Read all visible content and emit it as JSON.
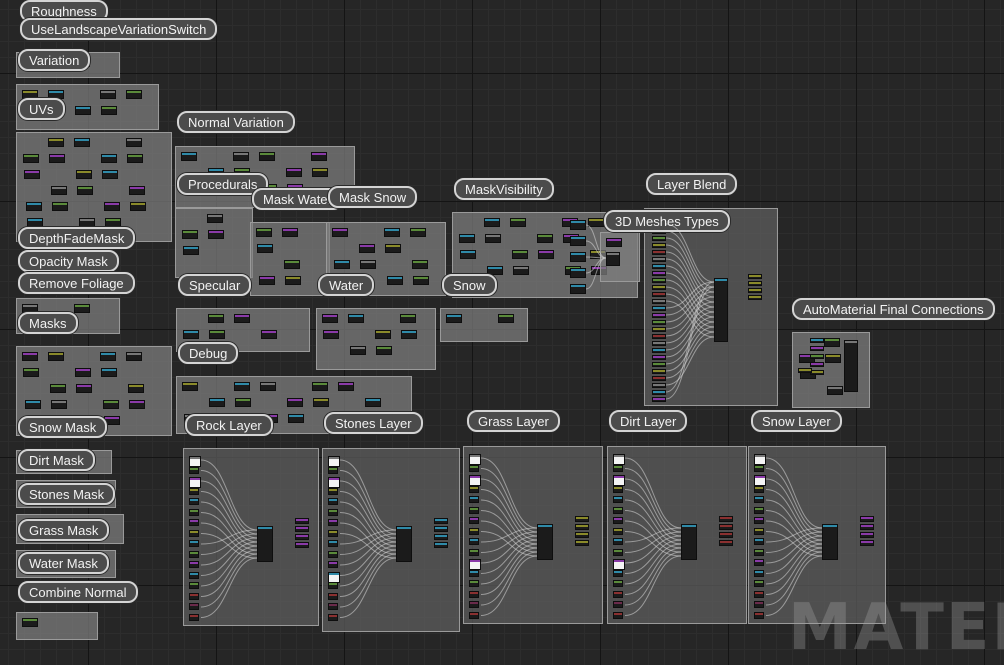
{
  "app": {
    "view": "Material Graph Editor",
    "watermark": "MATERIAL"
  },
  "comments": [
    {
      "id": "roughness",
      "title": "Roughness"
    },
    {
      "id": "landscape-variation",
      "title": "UseLandscapeVariationSwitch"
    },
    {
      "id": "variation",
      "title": "Variation"
    },
    {
      "id": "uvs",
      "title": "UVs"
    },
    {
      "id": "normal-variation",
      "title": "Normal Variation"
    },
    {
      "id": "procedurals",
      "title": "Procedurals"
    },
    {
      "id": "mask-water",
      "title": "Mask Water"
    },
    {
      "id": "mask-snow",
      "title": "Mask Snow"
    },
    {
      "id": "mask-visibility",
      "title": "MaskVisibility"
    },
    {
      "id": "layer-blend",
      "title": "Layer Blend"
    },
    {
      "id": "meshes-types",
      "title": "3D Meshes Types"
    },
    {
      "id": "depth-fade",
      "title": "DepthFadeMask"
    },
    {
      "id": "opacity-mask",
      "title": "Opacity Mask"
    },
    {
      "id": "remove-foliage",
      "title": "Remove Foliage"
    },
    {
      "id": "specular",
      "title": "Specular"
    },
    {
      "id": "water",
      "title": "Water"
    },
    {
      "id": "snow",
      "title": "Snow"
    },
    {
      "id": "automaterial-final",
      "title": "AutoMaterial Final Connections"
    },
    {
      "id": "masks",
      "title": "Masks"
    },
    {
      "id": "debug",
      "title": "Debug"
    },
    {
      "id": "snow-mask",
      "title": "Snow Mask"
    },
    {
      "id": "dirt-mask",
      "title": "Dirt Mask"
    },
    {
      "id": "stones-mask",
      "title": "Stones Mask"
    },
    {
      "id": "grass-mask",
      "title": "Grass Mask"
    },
    {
      "id": "water-mask",
      "title": "Water Mask"
    },
    {
      "id": "combine-normal",
      "title": "Combine Normal"
    },
    {
      "id": "rock-layer",
      "title": "Rock Layer"
    },
    {
      "id": "stones-layer",
      "title": "Stones Layer"
    },
    {
      "id": "grass-layer",
      "title": "Grass Layer"
    },
    {
      "id": "dirt-layer",
      "title": "Dirt Layer"
    },
    {
      "id": "snow-layer",
      "title": "Snow Layer"
    }
  ],
  "node_header_colors": {
    "teal": "#2f8aa8",
    "green": "#5a8a3a",
    "purple": "#8a3aa8",
    "olive": "#8a8a2a",
    "red": "#8a3030",
    "maroon": "#6a2a4a",
    "gray": "#777777",
    "blue": "#2a3ae8"
  },
  "colors": {
    "grid_background": "#262626",
    "comment_fill": "#808080",
    "comment_label_border": "#d4d4d4"
  }
}
